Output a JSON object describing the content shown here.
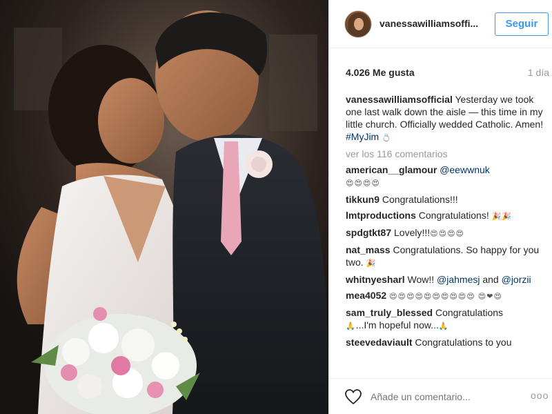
{
  "post": {
    "username": "vanessawilliamsoffi...",
    "follow_label": "Seguir",
    "likes": "4.026 Me gusta",
    "time_ago": "1 día",
    "caption": {
      "user": "vanessawilliamsofficial",
      "text": " Yesterday we took one last walk down the aisle — this time in my little church. Officially wedded Catholic. Amen! ",
      "hashtag": "#MyJim",
      "emoji": "💍"
    },
    "view_all": "ver los 116 comentarios",
    "comments": [
      {
        "user": "american__glamour",
        "text": " ",
        "mention": "@eewwnuk",
        "emoji": "😍😍😍😍"
      },
      {
        "user": "tikkun9",
        "text": " Congratulations!!!",
        "mention": "",
        "emoji": ""
      },
      {
        "user": "lmtproductions",
        "text": " Congratulations! ",
        "mention": "",
        "emoji": "🎉🎉"
      },
      {
        "user": "spdgtkt87",
        "text": " Lovely!!!",
        "mention": "",
        "emoji": "😍😍😍😍"
      },
      {
        "user": "nat_mass",
        "text": " Congratulations. So happy for you two. ",
        "mention": "",
        "emoji": "🎉"
      },
      {
        "user": "whitnyesharl",
        "text": " Wow!! ",
        "mention": "@jahmesj",
        "text2": " and ",
        "mention2": "@jorzii"
      },
      {
        "user": "mea4052",
        "text": " ",
        "mention": "",
        "emoji": "😍😍😍😍😍😍😍😍😍😍 😍❤😍"
      },
      {
        "user": "sam_truly_blessed",
        "text": " Congratulations ",
        "mention": "",
        "emoji": "🙏",
        "text2": "...I'm hopeful now...",
        "emoji2": "🙏"
      },
      {
        "user": "steevedaviault",
        "text": " Congratulations to you",
        "mention": "",
        "emoji": ""
      }
    ],
    "add_comment_placeholder": "Añade un comentario...",
    "more_label": "ooo"
  },
  "colors": {
    "accent": "#3897f0",
    "link": "#003569",
    "muted": "#999999",
    "text": "#262626"
  },
  "icons": {
    "heart": "heart-outline-icon",
    "more": "more-dots-icon"
  }
}
